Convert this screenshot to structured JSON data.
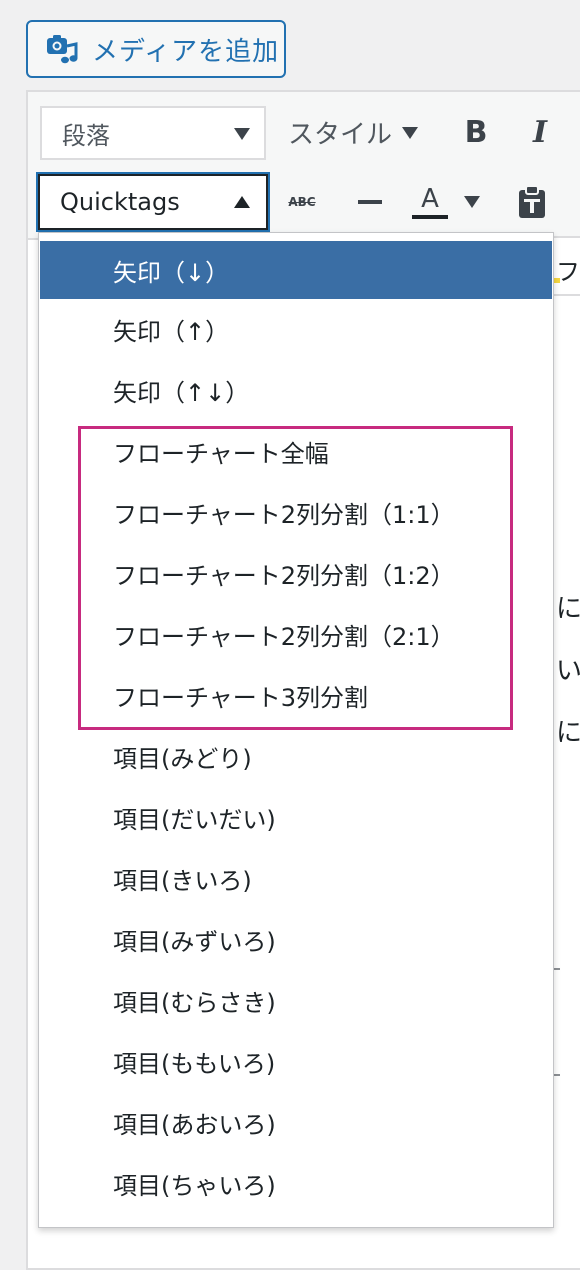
{
  "media_button": {
    "label": "メディアを追加",
    "icon": "media-camera-music-icon"
  },
  "toolbar": {
    "format_select": "段落",
    "style_label": "スタイル",
    "quicktags_select": "Quicktags",
    "bold_label": "B",
    "italic_label": "I",
    "strike_label": "ABC",
    "color_label": "A"
  },
  "behind_text": {
    "fragment1": "フ",
    "fragment2": "に",
    "fragment3": "いく",
    "fragment4": "にす"
  },
  "menu": {
    "items": [
      {
        "label": "矢印（↓）",
        "selected": true
      },
      {
        "label": "矢印（↑）"
      },
      {
        "label": "矢印（↑↓）"
      },
      {
        "label": "フローチャート全幅"
      },
      {
        "label": "フローチャート2列分割（1:1）"
      },
      {
        "label": "フローチャート2列分割（1:2）"
      },
      {
        "label": "フローチャート2列分割（2:1）"
      },
      {
        "label": "フローチャート3列分割"
      },
      {
        "label": "項目(みどり)"
      },
      {
        "label": "項目(だいだい)"
      },
      {
        "label": "項目(きいろ)"
      },
      {
        "label": "項目(みずいろ)"
      },
      {
        "label": "項目(むらさき)"
      },
      {
        "label": "項目(ももいろ)"
      },
      {
        "label": "項目(あおいろ)"
      },
      {
        "label": "項目(ちゃいろ)"
      }
    ]
  },
  "colors": {
    "accent": "#2271b1",
    "selected_bg": "#3a6ea5",
    "highlight_border": "#c72a7f"
  }
}
